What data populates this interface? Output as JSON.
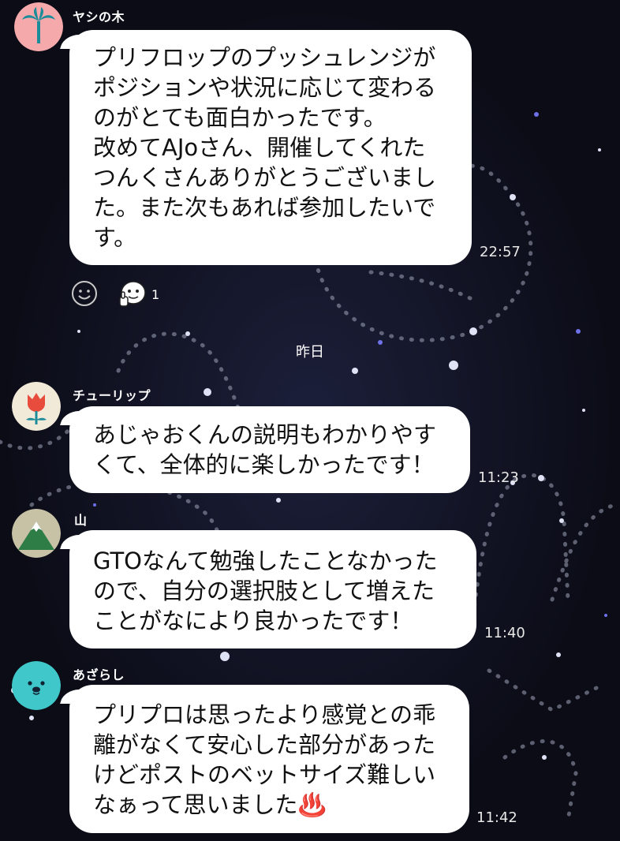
{
  "date_separator": "昨日",
  "messages": [
    {
      "sender": "ヤシの木",
      "avatar_icon": "palm-tree-icon",
      "avatar_bg": "#f6a9ab",
      "text": "プリフロップのプッシュレンジが\nポジションや状況に応じて変わる\nのがとても面白かったです。\n改めてAJoさん、開催してくれた\nつんくさんありがとうございまし\nた。また次もあれば参加したいで\nす。",
      "time": "22:57",
      "reaction_count": "1"
    },
    {
      "sender": "チューリップ",
      "avatar_icon": "tulip-icon",
      "avatar_bg": "#f2ead8",
      "text": "あじゃおくんの説明もわかりやす\nくて、全体的に楽しかったです！",
      "time": "11:23"
    },
    {
      "sender": "山",
      "avatar_icon": "mountain-icon",
      "avatar_bg": "#c7c1a6",
      "text": "GTOなんて勉強したことなかった\nので、自分の選択肢として増えた\nことがなにより良かったです！",
      "time": "11:40"
    },
    {
      "sender": "あざらし",
      "avatar_icon": "seal-icon",
      "avatar_bg": "#3fc7c9",
      "text": "プリプロは思ったより感覚との乖\n離がなくて安心した部分があった\nけどポストのベットサイズ難しい\nなぁって思いました♨️",
      "time": "11:42"
    }
  ],
  "colors": {
    "background": "#0b0c16",
    "bubble": "#ffffff",
    "text": "#111111"
  }
}
